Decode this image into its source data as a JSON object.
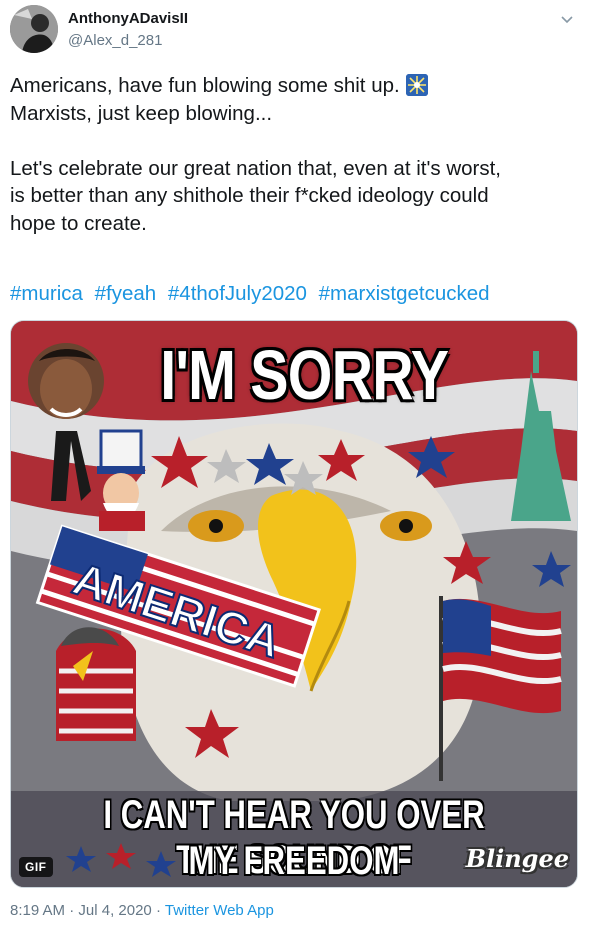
{
  "author": {
    "display_name": "AnthonyADavisII",
    "handle": "@Alex_d_281",
    "avatar_icon": "avatar-photo"
  },
  "tweet": {
    "line1": "Americans, have fun blowing some shit up.",
    "line1_emoji": "sparkler-emoji",
    "line2": "Marxists, just keep blowing...",
    "line3": "Let's celebrate our great nation that, even at it's worst,",
    "line4": "is better than any shithole their f*cked ideology could",
    "line5": "hope to create.",
    "hashtags": [
      "#murica",
      "#fyeah",
      "#4thofJuly2020",
      "#marxistgetcucked"
    ]
  },
  "media": {
    "top_text": "I'M SORRY",
    "bottom_text_1": "I CAN'T HEAR YOU OVER THE SOUND OF",
    "bottom_text_2": "MY FREEDOM",
    "watermark": "Blingee",
    "side_word": "AMERICA",
    "badge": "GIF"
  },
  "footer": {
    "time": "8:19 AM",
    "separator": "·",
    "date": "Jul 4, 2020",
    "source": "Twitter Web App"
  },
  "colors": {
    "link": "#1b95e0",
    "secondary_text": "#657786",
    "primary_text": "#14171a"
  }
}
